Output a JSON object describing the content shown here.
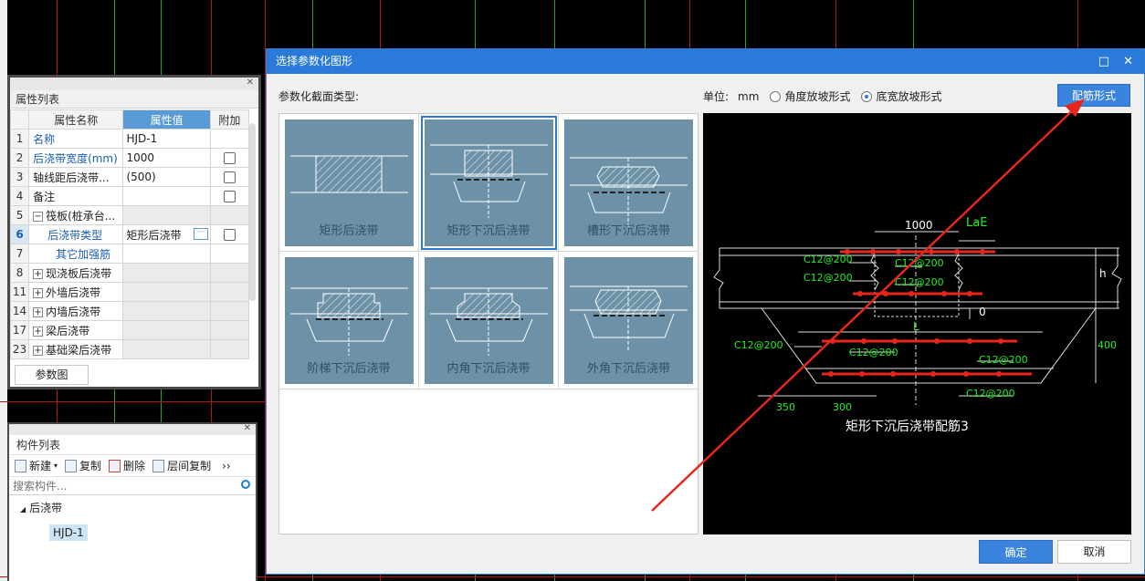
{
  "properties_panel": {
    "title": "属性列表",
    "columns": [
      "属性名称",
      "属性值",
      "附加"
    ],
    "rows": [
      {
        "num": "1",
        "name": "名称",
        "value": "HJD-1"
      },
      {
        "num": "2",
        "name": "后浇带宽度(mm)",
        "value": "1000"
      },
      {
        "num": "3",
        "name": "轴线距后浇带...",
        "value": "(500)"
      },
      {
        "num": "4",
        "name": "备注",
        "value": ""
      },
      {
        "num": "5",
        "name": "筏板(桩承台...",
        "value": ""
      },
      {
        "num": "6",
        "name": "后浇带类型",
        "value": "矩形后浇带"
      },
      {
        "num": "7",
        "name": "其它加强筋",
        "value": ""
      },
      {
        "num": "8",
        "name": "现浇板后浇带",
        "value": ""
      },
      {
        "num": "11",
        "name": "外墙后浇带",
        "value": ""
      },
      {
        "num": "14",
        "name": "内墙后浇带",
        "value": ""
      },
      {
        "num": "17",
        "name": "梁后浇带",
        "value": ""
      },
      {
        "num": "23",
        "name": "基础梁后浇带",
        "value": ""
      }
    ],
    "param_button": "参数图"
  },
  "component_panel": {
    "title": "构件列表",
    "toolbar": {
      "new": "新建",
      "copy": "复制",
      "delete": "删除",
      "floor_copy": "层间复制",
      "more": "››"
    },
    "search_placeholder": "搜索构件...",
    "tree_root": "后浇带",
    "tree_child": "HJD-1"
  },
  "dialog": {
    "title": "选择参数化图形",
    "section_label": "参数化截面类型:",
    "unit_label": "单位:",
    "unit_value": "mm",
    "radio_angle": "角度放坡形式",
    "radio_width": "底宽放坡形式",
    "rebar_button": "配筋形式",
    "tiles": [
      "矩形后浇带",
      "矩形下沉后浇带",
      "槽形下沉后浇带",
      "阶梯下沉后浇带",
      "内角下沉后浇带",
      "外角下沉后浇带"
    ],
    "selected_tile": "矩形下沉后浇带",
    "preview": {
      "dim_1000": "1000",
      "lae": "LaE",
      "h": "h",
      "l": "L",
      "zero": "0",
      "dim_400": "400",
      "dim_350": "350",
      "dim_300": "300",
      "rebar_labels": [
        "C12@200",
        "C12@200",
        "C12@200",
        "C12@200",
        "C12@200",
        "C12@200",
        "C12@200",
        "C12@200"
      ],
      "caption": "矩形下沉后浇带配筋3"
    },
    "ok": "确定",
    "cancel": "取消"
  },
  "colors": {
    "accent": "#2a7ad9",
    "tile_bg": "#6d92a8",
    "annotation": "#e8261c",
    "rebar": "#e8261c",
    "cad_text": "#22ee22"
  }
}
